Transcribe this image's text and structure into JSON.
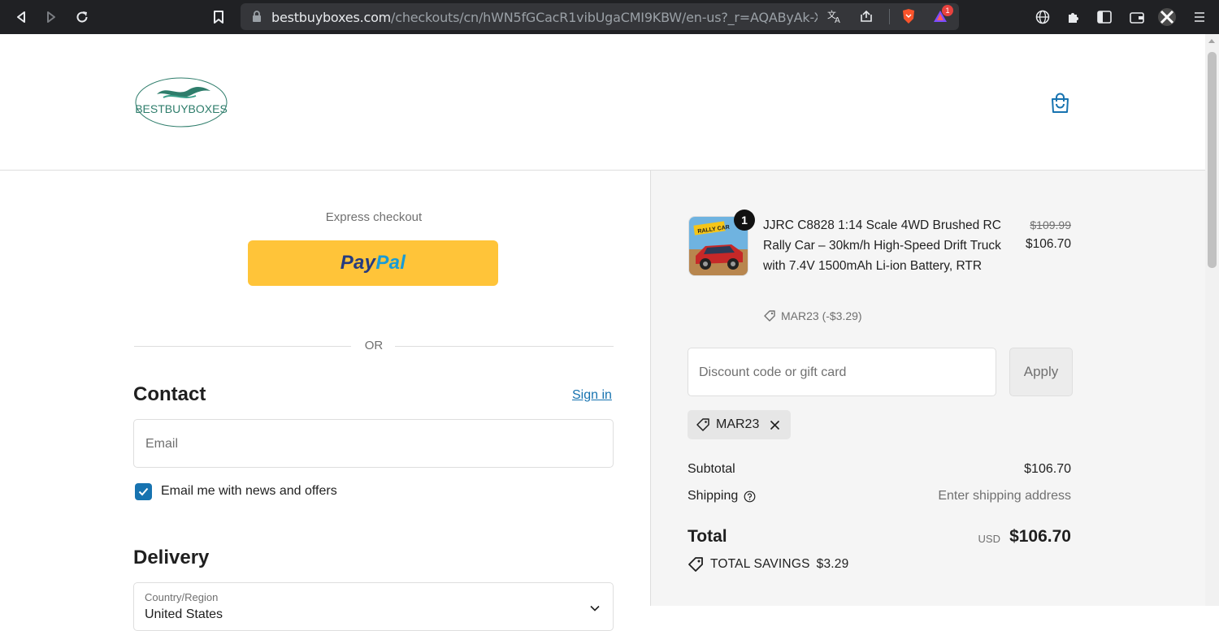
{
  "browser": {
    "url_host": "bestbuyboxes.com",
    "url_path": "/checkouts/cn/hWN5fGCacR1vibUgaCMI9KBW/en-us?_r=AQAByAk-Xgn...",
    "notification_count": "1"
  },
  "header": {
    "logo_text": "BESTBUYBOXES"
  },
  "checkout": {
    "express_label": "Express checkout",
    "paypal_part1": "Pay",
    "paypal_part2": "Pal",
    "or_label": "OR",
    "contact_heading": "Contact",
    "sign_in_link": "Sign in",
    "email_placeholder": "Email",
    "news_checkbox_label": "Email me with news and offers",
    "news_checkbox_checked": true,
    "delivery_heading": "Delivery",
    "country_label": "Country/Region",
    "country_value": "United States"
  },
  "summary": {
    "item": {
      "quantity": "1",
      "title": "JJRC C8828 1:14 Scale 4WD Brushed RC Rally Car – 30km/h High-Speed Drift Truck with 7.4V 1500mAh Li-ion Battery, RTR",
      "discount_tag": "MAR23 (-$3.29)",
      "original_price": "$109.99",
      "price": "$106.70",
      "thumbnail_text": "RALLY CAR"
    },
    "discount_placeholder": "Discount code or gift card",
    "apply_label": "Apply",
    "applied_code": "MAR23",
    "subtotal_label": "Subtotal",
    "subtotal_value": "$106.70",
    "shipping_label": "Shipping",
    "shipping_value": "Enter shipping address",
    "total_label": "Total",
    "total_currency": "USD",
    "total_value": "$106.70",
    "savings_label": "TOTAL SAVINGS",
    "savings_value": "$3.29"
  },
  "colors": {
    "link": "#1773b0",
    "paypal_yellow": "#ffc439",
    "logo_green": "#2e7d6b"
  }
}
